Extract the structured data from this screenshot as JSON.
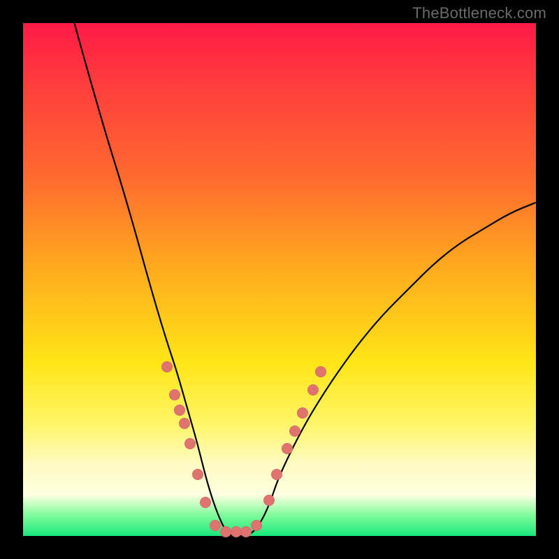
{
  "attribution": "TheBottleneck.com",
  "colors": {
    "page_bg": "#000000",
    "gradient_top": "#ff1a47",
    "gradient_bottom": "#17e87c",
    "curve_stroke": "#000000",
    "marker_fill": "#e0736f",
    "attribution_color": "#6a6a6a"
  },
  "chart_data": {
    "type": "line",
    "title": "",
    "xlabel": "",
    "ylabel": "",
    "xlim": [
      0,
      100
    ],
    "ylim": [
      0,
      100
    ],
    "grid": false,
    "legend": false,
    "series": [
      {
        "name": "bottleneck-curve",
        "comment": "x is horizontal position (0..100 left→right); y is 100 at top, 0 at bottom. Curve dips to ~0 near x≈40 then rises; right side reaches ~65 at x=100.",
        "x": [
          10,
          15,
          20,
          25,
          28,
          30,
          32,
          34,
          36,
          38,
          40,
          42,
          44,
          46,
          48,
          50,
          55,
          60,
          65,
          70,
          75,
          80,
          85,
          90,
          95,
          100
        ],
        "y": [
          100,
          82,
          66,
          48,
          38,
          32,
          25,
          18,
          10,
          4,
          0,
          0,
          0,
          2,
          6,
          12,
          22,
          30,
          37,
          43,
          48,
          53,
          57,
          60,
          63,
          65
        ]
      }
    ],
    "markers": {
      "comment": "Salmon dots near the valley, straddling the curve; same x/y convention as series.",
      "points": [
        {
          "x": 28.0,
          "y": 33.0
        },
        {
          "x": 29.5,
          "y": 27.5
        },
        {
          "x": 30.5,
          "y": 24.5
        },
        {
          "x": 31.5,
          "y": 22.0
        },
        {
          "x": 32.5,
          "y": 18.0
        },
        {
          "x": 34.0,
          "y": 12.0
        },
        {
          "x": 35.5,
          "y": 6.5
        },
        {
          "x": 37.5,
          "y": 2.0
        },
        {
          "x": 39.5,
          "y": 0.8
        },
        {
          "x": 41.5,
          "y": 0.8
        },
        {
          "x": 43.5,
          "y": 0.8
        },
        {
          "x": 45.5,
          "y": 2.0
        },
        {
          "x": 48.0,
          "y": 7.0
        },
        {
          "x": 49.5,
          "y": 12.0
        },
        {
          "x": 51.5,
          "y": 17.0
        },
        {
          "x": 53.0,
          "y": 20.5
        },
        {
          "x": 54.5,
          "y": 24.0
        },
        {
          "x": 56.5,
          "y": 28.5
        },
        {
          "x": 58.0,
          "y": 32.0
        }
      ]
    }
  }
}
